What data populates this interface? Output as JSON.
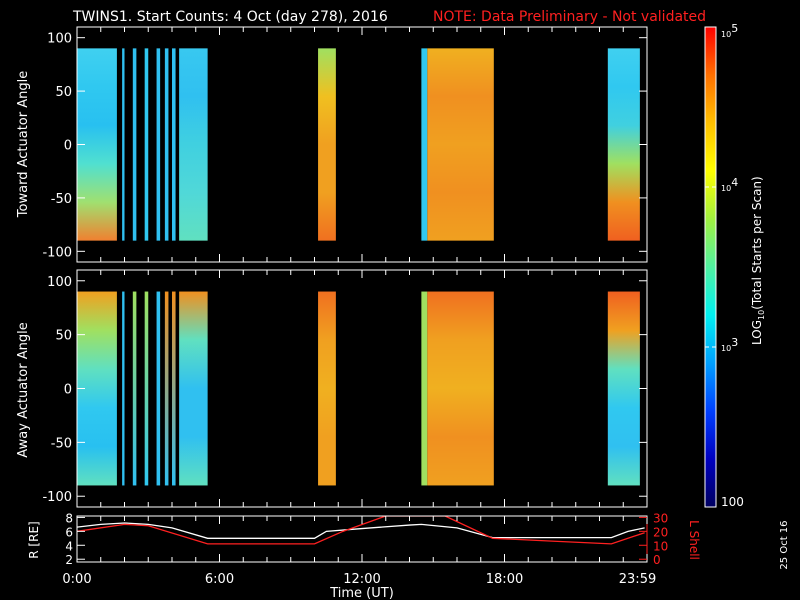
{
  "title": {
    "main": "TWINS1. Start Counts:  4 Oct (day 278), 2016",
    "note": "NOTE: Data Preliminary - Not validated"
  },
  "side_date": "25 Oct 16",
  "chart_data": [
    {
      "type": "heatmap",
      "name": "toward",
      "ylabel": "Toward Actuator Angle",
      "ylim": [
        -110,
        110
      ],
      "yticks": [
        "100",
        "50",
        "0",
        "-50",
        "-100"
      ],
      "ytick_values": [
        100,
        50,
        0,
        -50,
        -100
      ],
      "xlim_hours": [
        0,
        24
      ],
      "strips": [
        {
          "t": [
            0.0,
            1.68
          ],
          "colors": [
            "#40d0f0",
            "#30c8f0",
            "#28c0f0",
            "#50e0d0",
            "#a0e070",
            "#f08030"
          ]
        },
        {
          "t": [
            1.9,
            2.0
          ],
          "colors": [
            "#30c0f0",
            "#30c0f0"
          ]
        },
        {
          "t": [
            2.35,
            2.5
          ],
          "colors": [
            "#30c0f0",
            "#30c0f0"
          ]
        },
        {
          "t": [
            2.85,
            3.0
          ],
          "colors": [
            "#30c8f0",
            "#30c8f0"
          ]
        },
        {
          "t": [
            3.35,
            3.5
          ],
          "colors": [
            "#30c0f0",
            "#30c0f0"
          ]
        },
        {
          "t": [
            3.7,
            3.85
          ],
          "colors": [
            "#30c0f0",
            "#30c0f0"
          ]
        },
        {
          "t": [
            4.0,
            4.15
          ],
          "colors": [
            "#30c0f0",
            "#30c0f0"
          ]
        },
        {
          "t": [
            4.3,
            5.5
          ],
          "colors": [
            "#38c8f0",
            "#30c0f0",
            "#40d0e0",
            "#50d8d8",
            "#60e0c0"
          ]
        },
        {
          "t": [
            10.15,
            10.9
          ],
          "colors": [
            "#a0e060",
            "#f0c020",
            "#f0a020",
            "#f0a020",
            "#f07020"
          ]
        },
        {
          "t": [
            14.5,
            14.75
          ],
          "colors": [
            "#30c8f0",
            "#30c8f0"
          ]
        },
        {
          "t": [
            14.75,
            17.55
          ],
          "colors": [
            "#f0b020",
            "#f09020",
            "#f0a020",
            "#f09020",
            "#f0a020"
          ]
        },
        {
          "t": [
            22.35,
            23.7
          ],
          "colors": [
            "#40d0f0",
            "#30c8f0",
            "#40d0e0",
            "#a0e060",
            "#f09020",
            "#f06020"
          ]
        }
      ]
    },
    {
      "type": "heatmap",
      "name": "away",
      "ylabel": "Away Actuator Angle",
      "ylim": [
        -110,
        110
      ],
      "yticks": [
        "100",
        "50",
        "0",
        "-50",
        "-100"
      ],
      "ytick_values": [
        100,
        50,
        0,
        -50,
        -100
      ],
      "xlim_hours": [
        0,
        24
      ],
      "strips": [
        {
          "t": [
            0.0,
            1.68
          ],
          "colors": [
            "#f0a020",
            "#a0e060",
            "#60e0c0",
            "#30c8f0",
            "#28c0f0",
            "#60e0c0"
          ]
        },
        {
          "t": [
            1.9,
            2.0
          ],
          "colors": [
            "#30c0f0",
            "#30c0f0"
          ]
        },
        {
          "t": [
            2.35,
            2.5
          ],
          "colors": [
            "#a0e060",
            "#30c0f0"
          ]
        },
        {
          "t": [
            2.85,
            3.0
          ],
          "colors": [
            "#a0e060",
            "#30c8f0"
          ]
        },
        {
          "t": [
            3.35,
            3.5
          ],
          "colors": [
            "#30c0f0",
            "#30c0f0"
          ]
        },
        {
          "t": [
            3.7,
            3.85
          ],
          "colors": [
            "#f09020",
            "#30c0f0"
          ]
        },
        {
          "t": [
            4.0,
            4.15
          ],
          "colors": [
            "#f09020",
            "#30c0f0"
          ]
        },
        {
          "t": [
            4.3,
            5.5
          ],
          "colors": [
            "#f09020",
            "#60e0c0",
            "#30c0f0",
            "#30c0f0",
            "#60e0c0"
          ]
        },
        {
          "t": [
            10.15,
            10.9
          ],
          "colors": [
            "#f07020",
            "#f0a020",
            "#f0b020",
            "#f0a020",
            "#f0a020"
          ]
        },
        {
          "t": [
            14.5,
            14.75
          ],
          "colors": [
            "#a0e060",
            "#a0e060"
          ]
        },
        {
          "t": [
            14.75,
            17.55
          ],
          "colors": [
            "#f07020",
            "#f0a020",
            "#f0b020",
            "#f09020",
            "#f0a020"
          ]
        },
        {
          "t": [
            22.35,
            23.7
          ],
          "colors": [
            "#f06020",
            "#f0a020",
            "#60e0c0",
            "#30c8f0",
            "#30c0f0",
            "#60e0c0"
          ]
        }
      ]
    },
    {
      "type": "line",
      "name": "orbit",
      "ylabel": "R [RE]",
      "y2label": "L Shell",
      "xlabel": "Time (UT)",
      "xticks": [
        "0:00",
        "6:00",
        "12:00",
        "18:00",
        "23:59"
      ],
      "xtick_hours": [
        0,
        6,
        12,
        18,
        23.98
      ],
      "yticks": [
        "8",
        "6",
        "4",
        "2"
      ],
      "ylim": [
        1.6,
        8.2
      ],
      "y2ticks": [
        "30",
        "20",
        "10",
        "0"
      ],
      "y2lim": [
        -2,
        31
      ],
      "series": [
        {
          "name": "R",
          "color": "#ffffff",
          "x": [
            0,
            1,
            2,
            3,
            4,
            5.5,
            10,
            10.5,
            12,
            14,
            14.5,
            16,
            17.5,
            22.5,
            23.2,
            23.9
          ],
          "y": [
            6.6,
            7.0,
            7.2,
            7.0,
            6.5,
            5.0,
            5.0,
            6.0,
            6.4,
            6.9,
            7.0,
            6.5,
            5.1,
            5.1,
            6.0,
            6.5
          ]
        },
        {
          "name": "L Shell",
          "color": "#ff2020",
          "x": [
            0,
            2,
            3,
            5.5,
            10,
            11.2,
            13,
            15.5,
            17.5,
            20,
            22.5,
            23.9
          ],
          "y": [
            20,
            25,
            24,
            11,
            11,
            20,
            31,
            31,
            15,
            13,
            11,
            19
          ]
        }
      ]
    }
  ],
  "colorbar": {
    "label": "LOG10(Total Starts per Scan)",
    "label_main": "LOG",
    "label_sub": "10",
    "label_rest": "(Total Starts per Scan)",
    "ticks": [
      {
        "base": "10",
        "exp": "5"
      },
      {
        "base": "10",
        "exp": "4"
      },
      {
        "base": "10",
        "exp": "3"
      }
    ],
    "min_label": "100",
    "colors": [
      "#ff0000",
      "#ff7000",
      "#ffc000",
      "#ffff00",
      "#a0f040",
      "#50f0a0",
      "#00f0f0",
      "#00a0ff",
      "#0040ff",
      "#0000c0",
      "#000060"
    ]
  }
}
